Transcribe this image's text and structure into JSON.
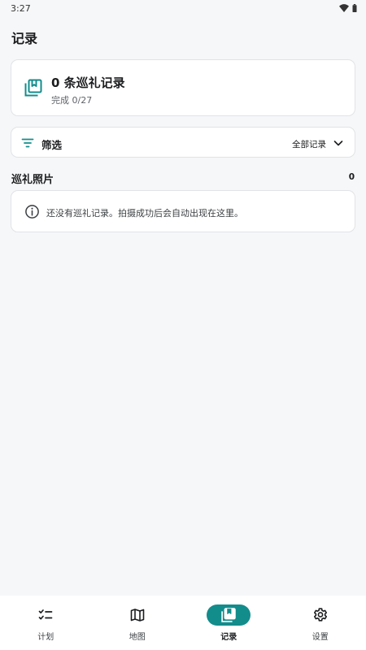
{
  "status_bar": {
    "time": "3:27",
    "icons": [
      "wifi-icon",
      "battery-icon"
    ]
  },
  "page": {
    "title": "记录"
  },
  "summary": {
    "icon": "collection-icon",
    "title": "0 条巡礼记录",
    "subtitle": "完成 0/27"
  },
  "filter": {
    "icon": "filter-icon",
    "label": "筛选",
    "value": "全部记录",
    "chevron": "chevron-down-icon"
  },
  "photos_section": {
    "title": "巡礼照片",
    "count": "0",
    "empty_message": "还没有巡礼记录。拍摄成功后会自动出现在这里。",
    "empty_icon": "info-icon"
  },
  "bottom_nav": {
    "items": [
      {
        "label": "计划",
        "icon": "checklist-icon",
        "active": false
      },
      {
        "label": "地图",
        "icon": "map-icon",
        "active": false
      },
      {
        "label": "记录",
        "icon": "collection-icon",
        "active": true
      },
      {
        "label": "设置",
        "icon": "gear-icon",
        "active": false
      }
    ]
  },
  "colors": {
    "accent": "#138c8c",
    "background": "#f6f7f9",
    "card": "#ffffff",
    "border": "#e1e3e6"
  }
}
